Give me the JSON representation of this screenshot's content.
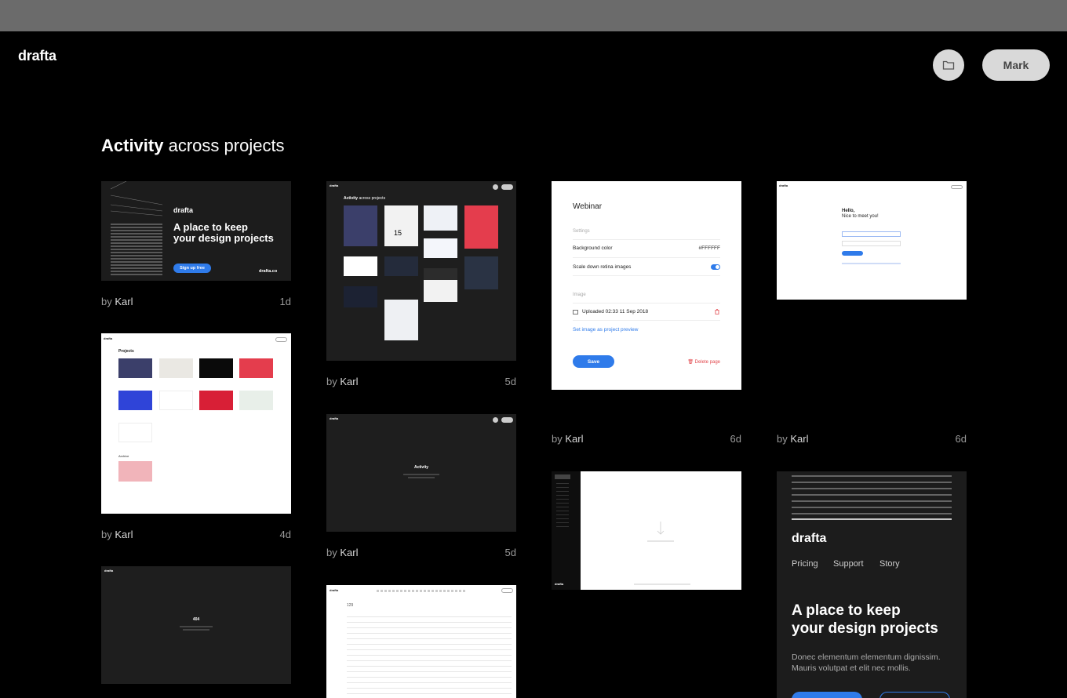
{
  "header": {
    "logo": "drafta",
    "user_button": "Mark"
  },
  "page": {
    "title_bold": "Activity",
    "title_rest": "across projects"
  },
  "cards": [
    {
      "by": "by",
      "author": "Karl",
      "age": "1d"
    },
    {
      "by": "by",
      "author": "Karl",
      "age": "5d"
    },
    {
      "by": "by",
      "author": "Karl",
      "age": "6d"
    },
    {
      "by": "by",
      "author": "Karl",
      "age": "6d"
    },
    {
      "by": "by",
      "author": "Karl",
      "age": "4d"
    },
    {
      "by": "by",
      "author": "Karl",
      "age": "5d"
    }
  ],
  "card1": {
    "logo": "drafta",
    "headline_1": "A place to keep",
    "headline_2": "your design projects",
    "cta": "Sign up free",
    "url": "drafta.co"
  },
  "card2": {
    "logo": "drafta",
    "title_bold": "Activity",
    "title_rest": "across projects",
    "number": "15"
  },
  "webinar": {
    "title": "Webinar",
    "section_settings": "Settings",
    "bg_label": "Background color",
    "bg_value": "#FFFFFF",
    "retina_label": "Scale down retina images",
    "section_image": "Image",
    "uploaded": "Uploaded 02:33 11 Sep 2018",
    "set_preview": "Set image as project preview",
    "save": "Save",
    "delete": "Delete page"
  },
  "login": {
    "logo": "drafta",
    "hello": "Hello,",
    "nice": "Nice to meet you!"
  },
  "projects": {
    "logo": "drafta",
    "title": "Projects",
    "archive": "Archive"
  },
  "activity_empty": {
    "logo": "drafta",
    "title": "Activity"
  },
  "upload": {
    "logo": "drafta"
  },
  "landing": {
    "logo": "drafta",
    "nav": [
      "Pricing",
      "Support",
      "Story"
    ],
    "headline_1": "A place to keep",
    "headline_2": "your design projects",
    "body_1": "Donec elementum elementum dignissim.",
    "body_2": "Mauris volutpat et elit nec mollis."
  },
  "notfound": {
    "logo": "drafta",
    "code": "404"
  },
  "table": {
    "logo": "drafta",
    "count": "129"
  },
  "colors": {
    "accent": "#2f7bea",
    "background": "#000000",
    "card_dark": "#1b1b1b",
    "danger": "#e2474c"
  }
}
